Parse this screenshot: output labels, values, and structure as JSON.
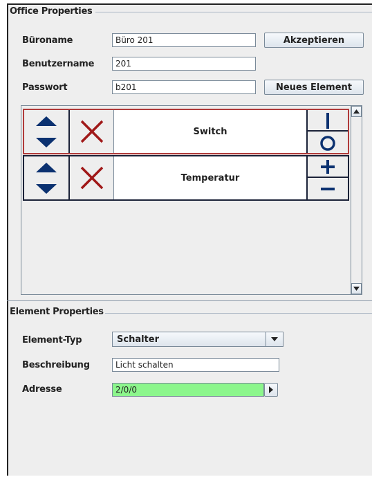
{
  "office": {
    "title": "Office Properties",
    "buroname_label": "Büroname",
    "buroname_value": "Büro 201",
    "benutzer_label": "Benutzername",
    "benutzer_value": "201",
    "passwort_label": "Passwort",
    "passwort_value": "b201",
    "akzeptieren_label": "Akzeptieren",
    "neues_element_label": "Neues Element"
  },
  "elements": [
    {
      "name": "Switch",
      "selected": true,
      "controls": [
        "power-on-icon",
        "power-off-icon"
      ]
    },
    {
      "name": "Temperatur",
      "selected": false,
      "controls": [
        "plus-icon",
        "minus-icon"
      ]
    }
  ],
  "element_props": {
    "title": "Element Properties",
    "typ_label": "Element-Typ",
    "typ_value": "Schalter",
    "beschreibung_label": "Beschreibung",
    "beschreibung_value": "Licht schalten",
    "adresse_label": "Adresse",
    "adresse_value": "2/0/0"
  },
  "colors": {
    "arrow": "#0b3170",
    "delete": "#a01818",
    "selected_border": "#b03a3a",
    "address_bg": "#8cf68c"
  }
}
